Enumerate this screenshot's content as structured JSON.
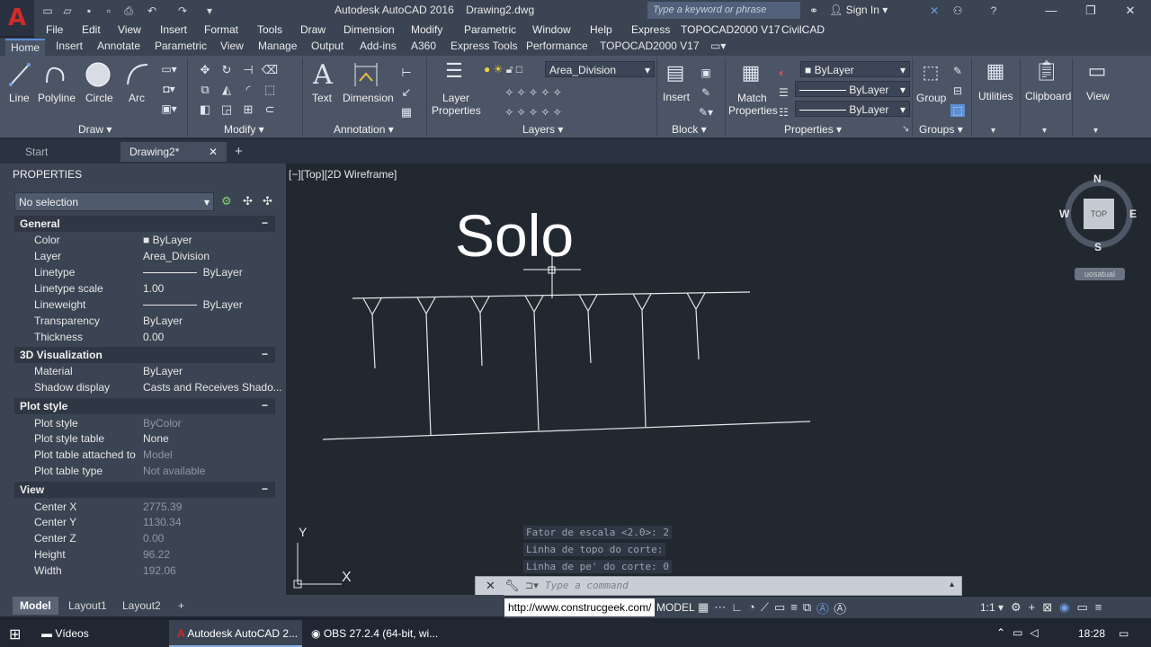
{
  "title_bar": {
    "app_title": "Autodesk AutoCAD 2016",
    "file_name": "Drawing2.dwg",
    "search_placeholder": "Type a keyword or phrase",
    "sign_in": "Sign In"
  },
  "menu": [
    "File",
    "Edit",
    "View",
    "Insert",
    "Format",
    "Tools",
    "Draw",
    "Dimension",
    "Modify",
    "Parametric",
    "Window",
    "Help",
    "Express",
    "TOPOCAD2000 V17",
    "CivilCAD"
  ],
  "ribbon_tabs": [
    "Home",
    "Insert",
    "Annotate",
    "Parametric",
    "View",
    "Manage",
    "Output",
    "Add-ins",
    "A360",
    "Express Tools",
    "Performance",
    "TOPOCAD2000 V17"
  ],
  "ribbon": {
    "draw": {
      "line": "Line",
      "polyline": "Polyline",
      "circle": "Circle",
      "arc": "Arc",
      "panel": "Draw"
    },
    "modify": {
      "panel": "Modify"
    },
    "annotation": {
      "text": "Text",
      "dimension": "Dimension",
      "panel": "Annotation"
    },
    "layers": {
      "layer_properties_1": "Layer",
      "layer_properties_2": "Properties",
      "current_layer": "Area_Division",
      "panel": "Layers"
    },
    "block": {
      "insert": "Insert",
      "panel": "Block"
    },
    "properties": {
      "match_1": "Match",
      "match_2": "Properties",
      "color": "ByLayer",
      "linetype": "ByLayer",
      "lineweight": "ByLayer",
      "panel": "Properties"
    },
    "groups": {
      "group": "Group",
      "panel": "Groups"
    },
    "utilities": "Utilities",
    "clipboard": "Clipboard",
    "view": "View"
  },
  "file_tabs": {
    "start": "Start",
    "drawing": "Drawing2*"
  },
  "properties_panel": {
    "title": "PROPERTIES",
    "selection": "No selection",
    "general": {
      "header": "General",
      "rows": [
        {
          "name": "Color",
          "value": "ByLayer"
        },
        {
          "name": "Layer",
          "value": "Area_Division"
        },
        {
          "name": "Linetype",
          "value": "ByLayer"
        },
        {
          "name": "Linetype scale",
          "value": "1.00"
        },
        {
          "name": "Lineweight",
          "value": "ByLayer"
        },
        {
          "name": "Transparency",
          "value": "ByLayer"
        },
        {
          "name": "Thickness",
          "value": "0.00"
        }
      ]
    },
    "viz": {
      "header": "3D Visualization",
      "rows": [
        {
          "name": "Material",
          "value": "ByLayer"
        },
        {
          "name": "Shadow display",
          "value": "Casts and Receives Shado..."
        }
      ]
    },
    "plot": {
      "header": "Plot style",
      "rows": [
        {
          "name": "Plot style",
          "value": "ByColor"
        },
        {
          "name": "Plot style table",
          "value": "None"
        },
        {
          "name": "Plot table attached to",
          "value": "Model"
        },
        {
          "name": "Plot table type",
          "value": "Not available"
        }
      ]
    },
    "view": {
      "header": "View",
      "rows": [
        {
          "name": "Center X",
          "value": "2775.39"
        },
        {
          "name": "Center Y",
          "value": "1130.34"
        },
        {
          "name": "Center Z",
          "value": "0.00"
        },
        {
          "name": "Height",
          "value": "96.22"
        },
        {
          "name": "Width",
          "value": "192.06"
        }
      ]
    }
  },
  "canvas": {
    "viewport_label": "[−][Top][2D Wireframe]",
    "drawing_text": "Solo",
    "viewcube": {
      "n": "N",
      "s": "S",
      "e": "E",
      "w": "W",
      "top": "TOP",
      "wcs": "uosatual"
    },
    "ucs": {
      "x": "X",
      "y": "Y"
    },
    "command_history": [
      "Fator de escala <2.0>: 2",
      "Linha de topo do corte:",
      "Linha de pe' do corte: 0"
    ],
    "command_placeholder": "Type a command"
  },
  "layout_tabs": [
    "Model",
    "Layout1",
    "Layout2"
  ],
  "status": {
    "url": "http://www.construcgeek.com/",
    "model": "MODEL",
    "scale": "1:1"
  },
  "taskbar": {
    "videos": "Vídeos",
    "autocad": "Autodesk AutoCAD 2...",
    "obs": "OBS 27.2.4 (64-bit, wi...",
    "clock": "18:28"
  },
  "colors": {
    "accent": "#5b8fd6",
    "canvas": "#212830",
    "brand_red": "#d02a2a"
  }
}
